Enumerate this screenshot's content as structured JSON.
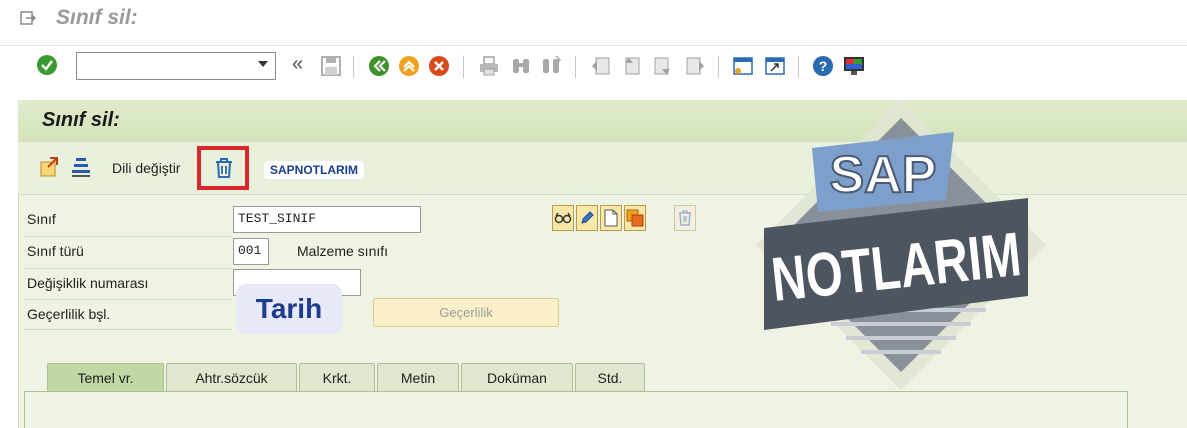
{
  "window": {
    "title": "Sınıf sil:"
  },
  "toolbar": {
    "command_field_value": ""
  },
  "screen": {
    "title": "Sınıf sil:",
    "dili_degistir_label": "Dili değiştir",
    "badge": "SAPNOTLARIM"
  },
  "form": {
    "sinif_label": "Sınıf",
    "sinif_value": "TEST_SINIF",
    "sinif_turu_label": "Sınıf türü",
    "sinif_turu_value": "001",
    "sinif_turu_desc": "Malzeme sınıfı",
    "degisiklik_label": "Değişiklik numarası",
    "degisiklik_value": "",
    "gecerlik_label": "Geçerlilik bşl.",
    "tarih_overlay": "Tarih",
    "gecerlik_button": "Geçerlilik"
  },
  "tabs": [
    {
      "label": "Temel vr."
    },
    {
      "label": "Ahtr.sözcük"
    },
    {
      "label": "Krkt."
    },
    {
      "label": "Metin"
    },
    {
      "label": "Doküman"
    },
    {
      "label": "Std."
    }
  ],
  "watermark": {
    "line1": "SAP",
    "line2": "NOTLARIM"
  },
  "colors": {
    "title_bar_text": "#9a9a9a",
    "inner_bg": "#eef3e3",
    "highlight_red": "#d8262b",
    "active_tab": "#c2d8a4"
  }
}
